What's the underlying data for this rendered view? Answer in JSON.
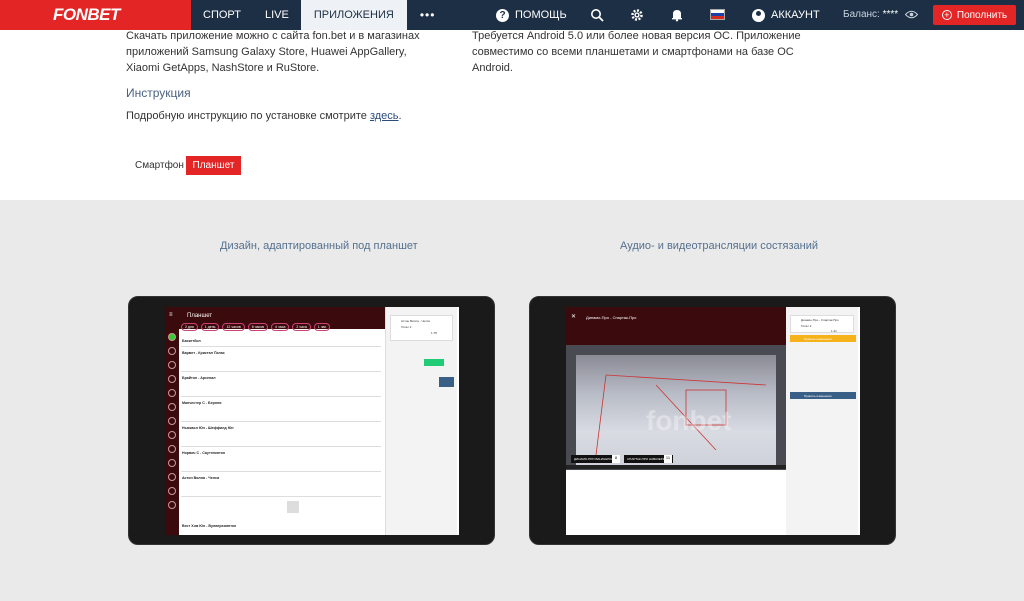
{
  "header": {
    "logo": "FONBET",
    "nav": [
      "СПОРТ",
      "LIVE",
      "ПРИЛОЖЕНИЯ"
    ],
    "more": "•••",
    "help": "ПОМОЩЬ",
    "account": "АККАУНТ",
    "balance_label": "Баланс:",
    "balance_value": "****",
    "topup": "Пополнить",
    "icons": [
      "help-icon",
      "search-icon",
      "gear-icon",
      "bell-icon",
      "flag-ru-icon",
      "user-icon",
      "eye-icon",
      "plus-icon"
    ]
  },
  "content": {
    "left_lines": [
      "Скачать приложение можно с сайта fon.bet и в магазинах",
      "приложений Samsung Galaxy Store, Huawei AppGallery,",
      "Xiaomi GetApps, NashStore и RuStore."
    ],
    "right_lines": [
      "Требуется Android 5.0 или более новая версия ОС. Приложение",
      "совместимо со всеми планшетами и смартфонами на базе ОС",
      "Android."
    ],
    "instruction_title": "Инструкция",
    "instruction_text": "Подробную инструкцию по установке смотрите",
    "instruction_link": "здесь",
    "instruction_end": ".",
    "tabs": [
      "Смартфон",
      "Планшет"
    ],
    "active_tab": "Планшет"
  },
  "features": [
    {
      "caption": "Дизайн, адаптированный под планшет"
    },
    {
      "caption": "Аудио- и видеотрансляции состязаний"
    }
  ],
  "tablet1": {
    "title": "Планшет",
    "pills": [
      "2 дня",
      "1 день",
      "12 часов",
      "6 часов",
      "4 часа",
      "2 часа",
      "1 час"
    ],
    "events": [
      "Баскетбол",
      "Вармет - Кристал Пэлас",
      "Брайтон - Арсенал",
      "Манчестер С - Бернли",
      "Ньюкасл Юн - Шеффилд Юн",
      "Норвич С - Саутгемптон",
      "Астон Вилла - Челси",
      "Вест Хэм Юн - Вулверхэмптон"
    ],
    "coupon_title": "Астон Вилла - Челси",
    "coupon_bet": "Тотал 2",
    "coupon_coef": "1.78"
  },
  "tablet2": {
    "title": "Динамо-Про - Спартак-Про",
    "coupon_title": "Динамо-Про - Спартак-Про",
    "coupon_bet": "Тотал 2",
    "coupon_coef": "1.41",
    "accept_btn": "Принять изменения",
    "place_btn": "Принять изменения",
    "score_left": "ДИНАМО-ПРО ВАНАЧЕРКАСТ",
    "score_right": "СПАРТАК-ПРО НАВАЧЕРКАСТ",
    "score_a": "8",
    "score_b": "11"
  }
}
